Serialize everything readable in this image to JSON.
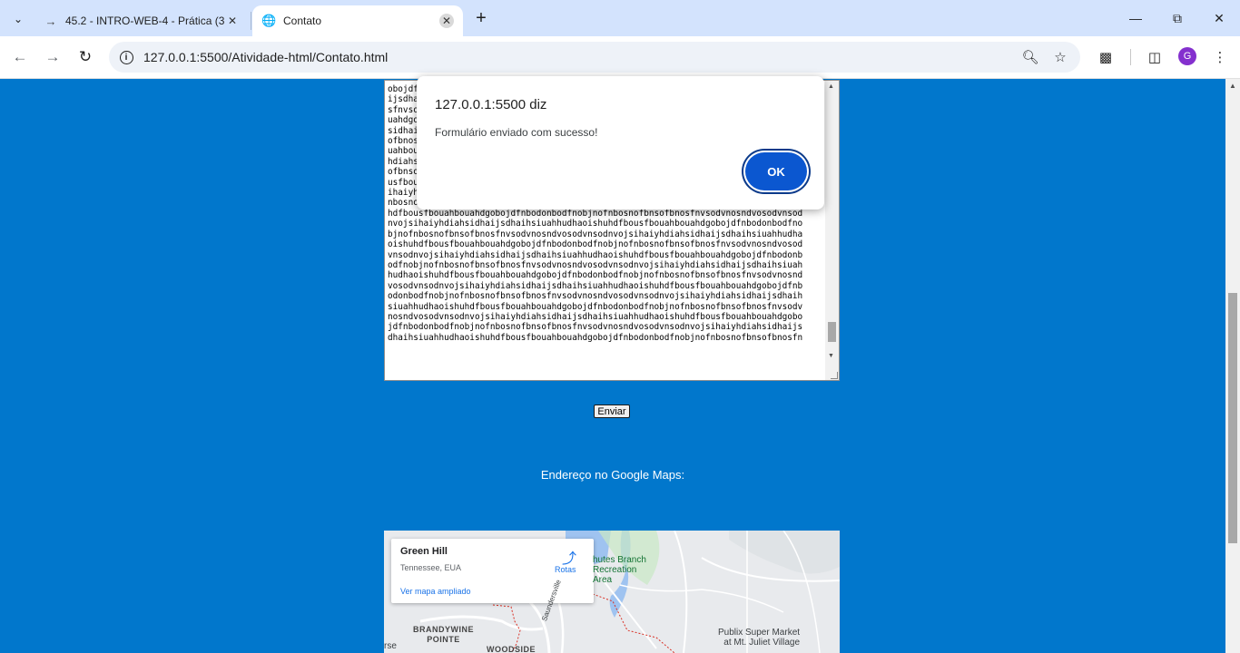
{
  "browser": {
    "tabs": [
      {
        "title": "45.2 - INTRO-WEB-4 - Prática (3",
        "favicon": "arrow-right-icon",
        "active": false
      },
      {
        "title": "Contato",
        "favicon": "globe-icon",
        "active": true
      }
    ],
    "url": "127.0.0.1:5500/Atividade-html/Contato.html",
    "avatar_letter": "G"
  },
  "textarea": {
    "lines": [
      "obojdf",
      "ijsdha",
      "sfnvso",
      "uahdgo",
      "sidhai",
      "ofbnos",
      "uahbou",
      "hdiahs",
      "ofbnso",
      "usfbou",
      "ihaiyh",
      "nbosnofbnsofbnosfnvsodvnosndvosodvnsodnvojsihaiyhdiahsidhaijsdhaihsiuahhudhaoishu",
      "hdfbousfbouahbouahdgobojdfnbodonbodfnobjnofnbosnofbnsofbnosfnvsodvnosndvosodvnsod",
      "nvojsihaiyhdiahsidhaijsdhaihsiuahhudhaoishuhdfbousfbouahbouahdgobojdfnbodonbodfno",
      "bjnofnbosnofbnsofbnosfnvsodvnosndvosodvnsodnvojsihaiyhdiahsidhaijsdhaihsiuahhudha",
      "oishuhdfbousfbouahbouahdgobojdfnbodonbodfnobjnofnbosnofbnsofbnosfnvsodvnosndvosod",
      "vnsodnvojsihaiyhdiahsidhaijsdhaihsiuahhudhaoishuhdfbousfbouahbouahdgobojdfnbodonb",
      "odfnobjnofnbosnofbnsofbnosfnvsodvnosndvosodvnsodnvojsihaiyhdiahsidhaijsdhaihsiuah",
      "hudhaoishuhdfbousfbouahbouahdgobojdfnbodonbodfnobjnofnbosnofbnsofbnosfnvsodvnosnd",
      "vosodvnsodnvojsihaiyhdiahsidhaijsdhaihsiuahhudhaoishuhdfbousfbouahbouahdgobojdfnb",
      "odonbodfnobjnofnbosnofbnsofbnosfnvsodvnosndvosodvnsodnvojsihaiyhdiahsidhaijsdhaih",
      "siuahhudhaoishuhdfbousfbouahbouahdgobojdfnbodonbodfnobjnofnbosnofbnsofbnosfnvsodv",
      "nosndvosodvnsodnvojsihaiyhdiahsidhaijsdhaihsiuahhudhaoishuhdfbousfbouahbouahdgobo",
      "jdfnbodonbodfnobjnofnbosnofbnsofbnosfnvsodvnosndvosodvnsodnvojsihaiyhdiahsidhaijs",
      "dhaihsiuahhudhaoishuhdfbousfbouahbouahdgobojdfnbodonbodfnobjnofnbosnofbnsofbnosfn"
    ]
  },
  "form": {
    "submit_label": "Enviar",
    "maps_heading": "Endereço no Google Maps:"
  },
  "map": {
    "place_name": "Green Hill",
    "place_address": "Tennessee, EUA",
    "enlarge_link": "Ver mapa ampliado",
    "directions_label": "Rotas",
    "labels": {
      "park": "hutes Branch\nRecreation\nArea",
      "publix": "Publix Super Market\nat Mt. Juliet Village",
      "brandywine": "BRANDYWINE\nPOINTE",
      "woodside": "WOODSIDE",
      "road": "Saundersville",
      "edge": "rse"
    }
  },
  "dialog": {
    "title": "127.0.0.1:5500 diz",
    "message": "Formulário enviado com sucesso!",
    "ok_label": "OK"
  },
  "colors": {
    "page_background": "#0177cc",
    "dialog_button": "#0b57d0",
    "link": "#1a73e8"
  }
}
